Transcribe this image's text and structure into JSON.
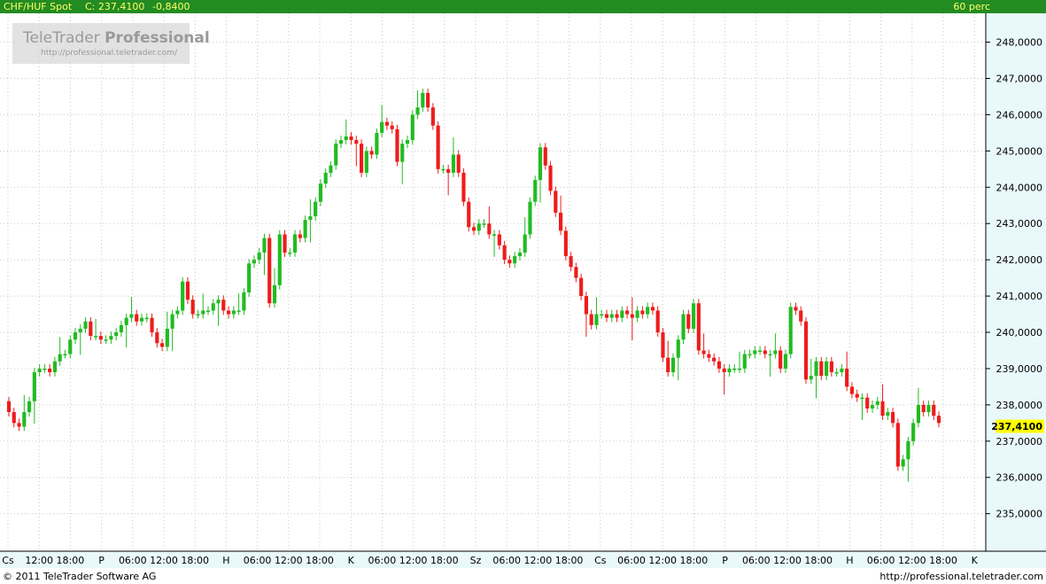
{
  "header": {
    "symbol": "CHF/HUF Spot",
    "close_label": "C: 237,4100",
    "change": "-0,8400",
    "interval": "60 perc"
  },
  "watermark": {
    "brand_regular": "TeleTrader ",
    "brand_bold": "Professional",
    "url": "http://professional.teletrader.com/"
  },
  "footer": {
    "copyright": "© 2011  TeleTrader Software AG",
    "url": "http://professional.teletrader.com"
  },
  "colors": {
    "up": "#22bb22",
    "down": "#ee1c1c",
    "header_bg": "#228b22",
    "header_text": "#ffff66",
    "axis_bg": "#e9f8fb",
    "last_price_bg": "#ffff00"
  },
  "chart_data": {
    "type": "candlestick",
    "last_price_label": "237,4100",
    "y_ticks": [
      "248,0000",
      "247,0000",
      "246,0000",
      "245,0000",
      "244,0000",
      "243,0000",
      "242,0000",
      "241,0000",
      "240,0000",
      "239,0000",
      "238,0000",
      "237,0000",
      "236,0000",
      "235,0000"
    ],
    "y_tick_values": [
      248,
      247,
      246,
      245,
      244,
      243,
      242,
      241,
      240,
      239,
      238,
      237,
      236,
      235
    ],
    "x_ticks": [
      "Cs",
      "12:00",
      "18:00",
      "P",
      "06:00",
      "12:00",
      "18:00",
      "H",
      "06:00",
      "12:00",
      "18:00",
      "K",
      "06:00",
      "12:00",
      "18:00",
      "Sz",
      "06:00",
      "12:00",
      "18:00",
      "Cs",
      "06:00",
      "12:00",
      "18:00",
      "P",
      "06:00",
      "12:00",
      "18:00",
      "H",
      "06:00",
      "12:00",
      "18:00",
      "K"
    ],
    "ylim": [
      234.2,
      248.6
    ],
    "close_series": [
      237.8,
      237.5,
      237.4,
      237.8,
      238.1,
      238.9,
      239.0,
      239.0,
      238.9,
      239.2,
      239.4,
      239.4,
      239.8,
      240.0,
      240.1,
      240.3,
      239.9,
      239.9,
      239.8,
      239.8,
      239.9,
      240.0,
      240.2,
      240.4,
      240.5,
      240.3,
      240.4,
      240.4,
      240.0,
      239.7,
      239.6,
      240.1,
      240.5,
      240.6,
      241.4,
      240.9,
      240.5,
      240.5,
      240.6,
      240.6,
      240.8,
      240.9,
      240.6,
      240.5,
      240.6,
      240.6,
      241.1,
      241.9,
      242.0,
      242.2,
      242.6,
      240.8,
      241.3,
      242.7,
      242.2,
      242.2,
      242.7,
      242.6,
      243.1,
      243.2,
      243.6,
      244.1,
      244.4,
      244.6,
      245.2,
      245.3,
      245.4,
      245.3,
      245.2,
      244.4,
      245.0,
      244.9,
      245.5,
      245.8,
      245.7,
      245.6,
      244.7,
      245.2,
      245.3,
      246.0,
      246.2,
      246.6,
      246.2,
      245.7,
      244.5,
      244.5,
      244.4,
      244.9,
      244.4,
      243.6,
      242.9,
      242.8,
      243.0,
      243.0,
      242.7,
      242.7,
      242.4,
      242.0,
      241.9,
      242.1,
      242.2,
      242.7,
      243.6,
      244.2,
      245.1,
      244.6,
      243.9,
      243.3,
      242.8,
      242.1,
      241.8,
      241.5,
      241.0,
      240.5,
      240.2,
      240.5,
      240.5,
      240.4,
      240.5,
      240.4,
      240.6,
      240.5,
      240.4,
      240.6,
      240.5,
      240.7,
      240.6,
      240.0,
      239.3,
      238.9,
      239.3,
      239.8,
      240.5,
      240.1,
      240.8,
      239.5,
      239.4,
      239.3,
      239.2,
      239.0,
      238.9,
      239.0,
      239.0,
      239.0,
      239.4,
      239.4,
      239.5,
      239.5,
      239.4,
      239.4,
      239.5,
      239.0,
      239.4,
      240.7,
      240.6,
      240.3,
      238.7,
      238.8,
      239.2,
      238.8,
      239.2,
      238.9,
      238.9,
      239.0,
      238.5,
      238.3,
      238.2,
      238.2,
      237.9,
      238.0,
      238.1,
      237.7,
      237.8,
      237.5,
      236.3,
      236.5,
      237.0,
      237.5,
      238.0,
      237.8,
      238.0,
      237.7,
      237.5
    ]
  }
}
